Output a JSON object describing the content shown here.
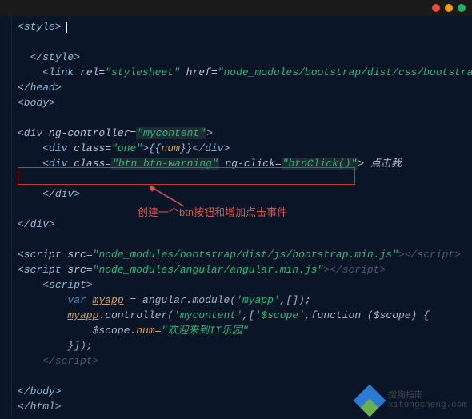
{
  "titlebar": {
    "dots": [
      "red",
      "yellow",
      "green"
    ]
  },
  "code": {
    "l1_open": "<style>",
    "l2_close": "</style>",
    "l3_link_open": "<link ",
    "l3_rel_attr": "rel=",
    "l3_rel_val": "\"stylesheet\"",
    "l3_href_attr": " href=",
    "l3_href_val": "\"node_modules/bootstrap/dist/css/bootstrap.min.css\"",
    "l4_headclose": "</head>",
    "l5_body": "<body>",
    "l6_div": "<div ",
    "l6_attr": "ng-controller=",
    "l6_val": "\"mycontent\"",
    "l6_end": ">",
    "l7_div": "<div ",
    "l7_attr": "class=",
    "l7_val": "\"one\"",
    "l7_mid": ">{{",
    "l7_num": "num",
    "l7_close": "}}</div>",
    "l8_div": "<div ",
    "l8_class_attr": "class=",
    "l8_class_val": "\"btn btn-warning\"",
    "l8_click_attr": " ng-click=",
    "l8_click_val": "\"btnClick()\"",
    "l8_text": "> 点击我",
    "l9_divclose": "</div>",
    "l10_divclose": "</div>",
    "l11_s1a": "<script ",
    "l11_attr": "src=",
    "l11_val": "\"node_modules/bootstrap/dist/js/bootstrap.min.js\"",
    "l11_s1b": "></script>",
    "l12_val": "\"node_modules/angular/angular.min.js\"",
    "l13_open": "<script>",
    "l14_var": "var ",
    "l14_name": "myapp",
    "l14_eq": " = angular.module(",
    "l14_arg1": "'myapp'",
    "l14_arg2": ",[]);",
    "l15_name": "myapp",
    "l15_ctrl": ".controller(",
    "l15_a1": "'mycontent'",
    "l15_a2": ",[",
    "l15_a3": "'$scope'",
    "l15_a4": ",function ($scope) {",
    "l16_scope": "$scope.",
    "l16_prop": "num",
    "l16_eq": "=",
    "l16_val": "\"欢迎来到IT乐园\"",
    "l17_close": "}]);",
    "l18_sclose": "</script>",
    "l19_bodyclose": "</body>",
    "l20_htmlclose": "</html>"
  },
  "annotation": {
    "text": "创建一个btn按钮和增加点击事件"
  },
  "watermark": {
    "line1": "搜狗指南",
    "line2": "xitongcheng.com"
  }
}
